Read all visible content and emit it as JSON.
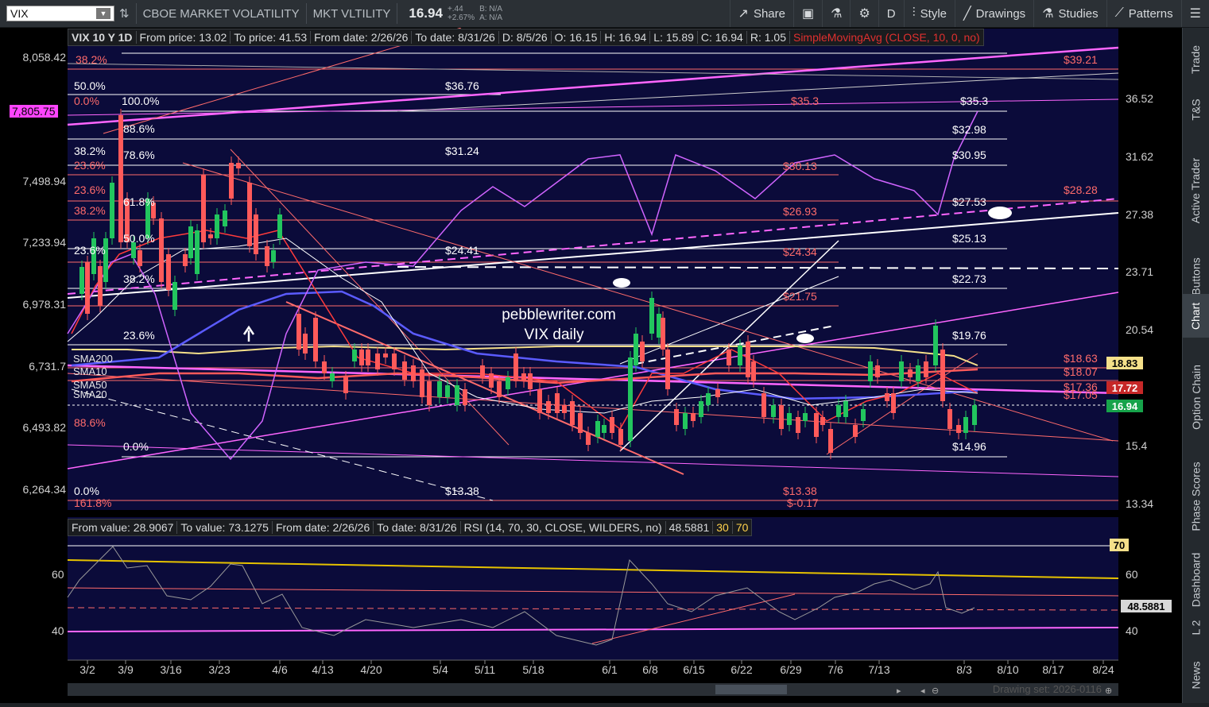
{
  "toolbar": {
    "symbol": "VIX",
    "description": "CBOE MARKET VOLATILITY",
    "short_name": "MKT VLTILITY",
    "last": "16.94",
    "change": "+.44",
    "change_pct": "+2.67%",
    "bid": "B: N/A",
    "ask": "A: N/A",
    "share_label": "Share",
    "timeframe": "D",
    "style_label": "Style",
    "drawings_label": "Drawings",
    "studies_label": "Studies",
    "patterns_label": "Patterns"
  },
  "header": {
    "title": "VIX 10 Y 1D",
    "from_price": "From price: 13.02",
    "to_price": "To price: 41.53",
    "from_date": "From date: 2/26/26",
    "to_date": "To date: 8/31/26",
    "d": "D: 8/5/26",
    "o": "O: 16.15",
    "h": "H: 16.94",
    "l": "L: 15.89",
    "c": "C: 16.94",
    "r": "R: 1.05",
    "study": "SimpleMovingAvg (CLOSE, 10, 0, no)"
  },
  "rsi_header": {
    "from_value": "From value: 28.9067",
    "to_value": "To value: 73.1275",
    "from_date": "From date: 2/26/26",
    "to_date": "To date: 8/31/26",
    "study": "RSI (14, 70, 30, CLOSE, WILDERS, no)",
    "value": "48.5881",
    "lower": "30",
    "upper": "70"
  },
  "right_axis": [
    "36.52",
    "31.62",
    "27.38",
    "23.71",
    "20.54",
    "15.4",
    "13.34"
  ],
  "left_axis": [
    "8,058.42",
    "7,498.94",
    "7,233.94",
    "6,978.31",
    "6,731.7",
    "6,493.82",
    "6,264.34"
  ],
  "left_axis_highlight": "7,805.75",
  "price_boxes": {
    "sma_a": "18.83",
    "sma_b": "17.72",
    "last": "16.94"
  },
  "rsi_axis": [
    "60",
    "40"
  ],
  "rsi_boxes": {
    "upper": "70",
    "value": "48.5881"
  },
  "x_axis": [
    "3/2",
    "3/9",
    "3/16",
    "3/23",
    "4/6",
    "4/13",
    "4/20",
    "5/4",
    "5/11",
    "5/18",
    "6/1",
    "6/8",
    "6/15",
    "6/22",
    "6/29",
    "7/6",
    "7/13",
    "8/3",
    "8/10",
    "8/17",
    "8/24"
  ],
  "fib_labels": [
    "38.2%",
    "50.0%",
    "0.0%",
    "100.0%",
    "88.6%",
    "38.2%",
    "78.6%",
    "23.6%",
    "23.6%",
    "61.8%",
    "38.2%",
    "50.0%",
    "23.6%",
    "38.2%",
    "23.6%",
    "88.6%",
    "0.0%",
    "0.0%",
    "161.8%"
  ],
  "price_levels_white": [
    "$36.76",
    "$31.24",
    "$24.41",
    "$13.38",
    "$35.3",
    "$32.98",
    "$30.95",
    "$27.53",
    "$25.13",
    "$22.73",
    "$19.76",
    "$14.96"
  ],
  "price_levels_red": [
    "$39.21",
    "$35.3",
    "$30.13",
    "$28.28",
    "$26.93",
    "$24.34",
    "$21.75",
    "$18.63",
    "$18.07",
    "$17.36",
    "$17.05",
    "$13.38",
    "$-0.17"
  ],
  "sma_labels": [
    "SMA200",
    "SMA10",
    "SMA50",
    "SMA20"
  ],
  "watermark": {
    "line1": "pebblewriter.com",
    "line2": "VIX daily"
  },
  "footer": {
    "drawing_set": "Drawing set: 2026-0116"
  },
  "sidebar": [
    "Trade",
    "T&S",
    "Active Trader",
    "Buttons",
    "Chart",
    "Option Chain",
    "Phase Scores",
    "Dashboard",
    "L 2",
    "News"
  ],
  "colors": {
    "up": "#22c55e",
    "down": "#ff5a5a",
    "fib": "#ffffff",
    "sma200": "#f5e08a",
    "sma50": "#6b6bff",
    "magenta": "#ff66ff"
  }
}
